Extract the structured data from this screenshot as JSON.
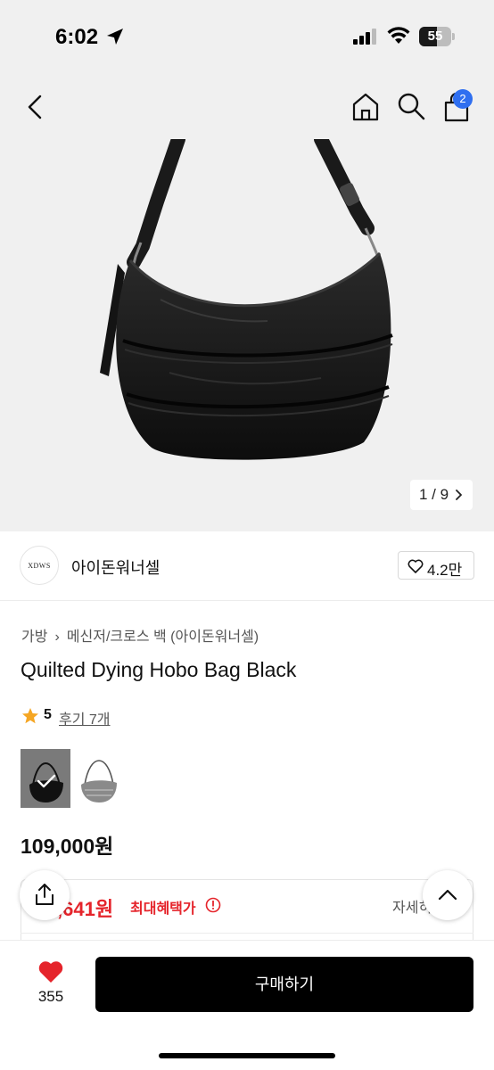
{
  "status_bar": {
    "time": "6:02",
    "battery": "55",
    "battery_level": 0.55
  },
  "nav": {
    "cart_count": "2"
  },
  "gallery": {
    "page_indicator": "1 / 9"
  },
  "brand": {
    "logo_text": "XDWS",
    "name": "아이돈워너셀",
    "likes": "4.2만"
  },
  "category": {
    "level1": "가방",
    "level2": "메신저/크로스 백 (아이돈워너셀)"
  },
  "product": {
    "title": "Quilted Dying Hobo Bag Black",
    "rating": "5",
    "reviews": "후기 7개",
    "price": "109,000원"
  },
  "benefit": {
    "price": ",641원",
    "label": "최대혜택가",
    "detail": "자세히"
  },
  "bottom_bar": {
    "wish_count": "355",
    "buy_label": "구매하기"
  },
  "colors": {
    "accent_red": "#e5242b",
    "badge_blue": "#2f6ff0",
    "star": "#f5a623"
  }
}
